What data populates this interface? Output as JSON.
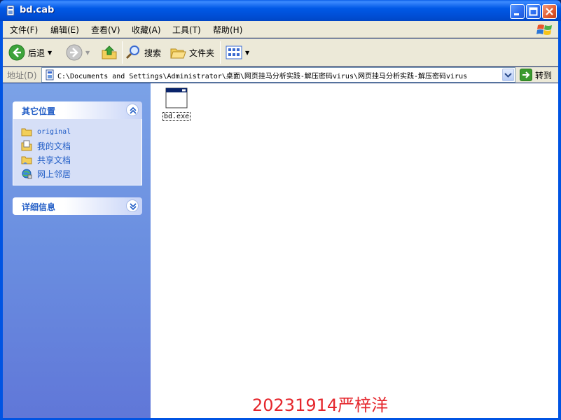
{
  "window": {
    "title": "bd.cab"
  },
  "menu": [
    "文件(F)",
    "编辑(E)",
    "查看(V)",
    "收藏(A)",
    "工具(T)",
    "帮助(H)"
  ],
  "toolbar": {
    "back_label": "后退",
    "search_label": "搜索",
    "folders_label": "文件夹"
  },
  "address": {
    "label": "地址(D)",
    "path": "C:\\Documents and Settings\\Administrator\\桌面\\网页挂马分析实践-解压密码virus\\网页挂马分析实践-解压密码virus",
    "go_label": "转到"
  },
  "taskpane": {
    "other_places": {
      "title": "其它位置",
      "items": [
        "original",
        "我的文档",
        "共享文档",
        "网上邻居"
      ]
    },
    "details": {
      "title": "详细信息"
    }
  },
  "files": [
    {
      "name": "bd.exe"
    }
  ],
  "watermark": "20231914严梓洋",
  "colors": {
    "title_blue": "#0058E6",
    "task_link": "#215DC6",
    "watermark": "#E5262C"
  }
}
